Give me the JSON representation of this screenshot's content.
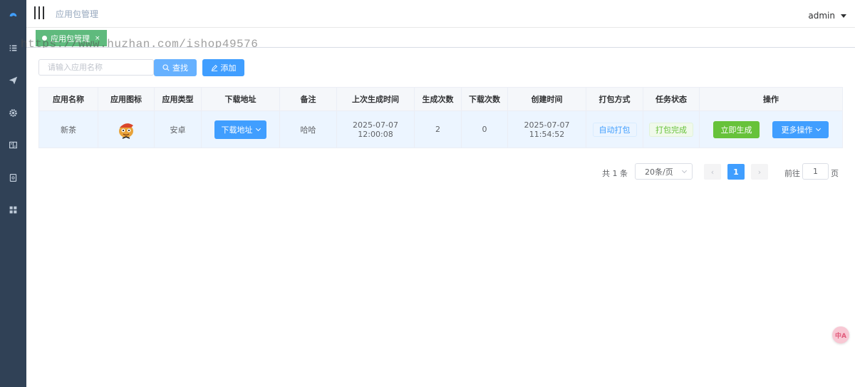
{
  "topbar": {
    "breadcrumb": "应用包管理",
    "user": "admin"
  },
  "tags": [
    {
      "label": "应用包管理",
      "close": "×"
    }
  ],
  "watermark": "https://www.huzhan.com/ishop49576",
  "toolbar": {
    "search_placeholder": "请输入应用名称",
    "search_label": "查找",
    "add_label": "添加"
  },
  "table": {
    "columns": [
      "应用名称",
      "应用图标",
      "应用类型",
      "下载地址",
      "备注",
      "上次生成时间",
      "生成次数",
      "下载次数",
      "创建时间",
      "打包方式",
      "任务状态",
      "操作"
    ],
    "rows": [
      {
        "name": "新茶",
        "type": "安卓",
        "download_label": "下载地址",
        "remark": "哈哈",
        "last_generated": "2025-07-07 12:00:08",
        "generate_count": "2",
        "download_count": "0",
        "created": "2025-07-07 11:54:52",
        "pack_mode": "自动打包",
        "task_status": "打包完成",
        "generate_label": "立即生成",
        "more_label": "更多操作"
      }
    ]
  },
  "pagination": {
    "total": "共 1 条",
    "page_size": "20条/页",
    "current": "1",
    "goto_prefix": "前往",
    "goto_value": "1",
    "goto_suffix": "页"
  },
  "float_badge": "中A",
  "colors": {
    "sidebar": "#304156",
    "primary": "#409eff",
    "success": "#67c23a",
    "tag": "#5fba7d"
  }
}
